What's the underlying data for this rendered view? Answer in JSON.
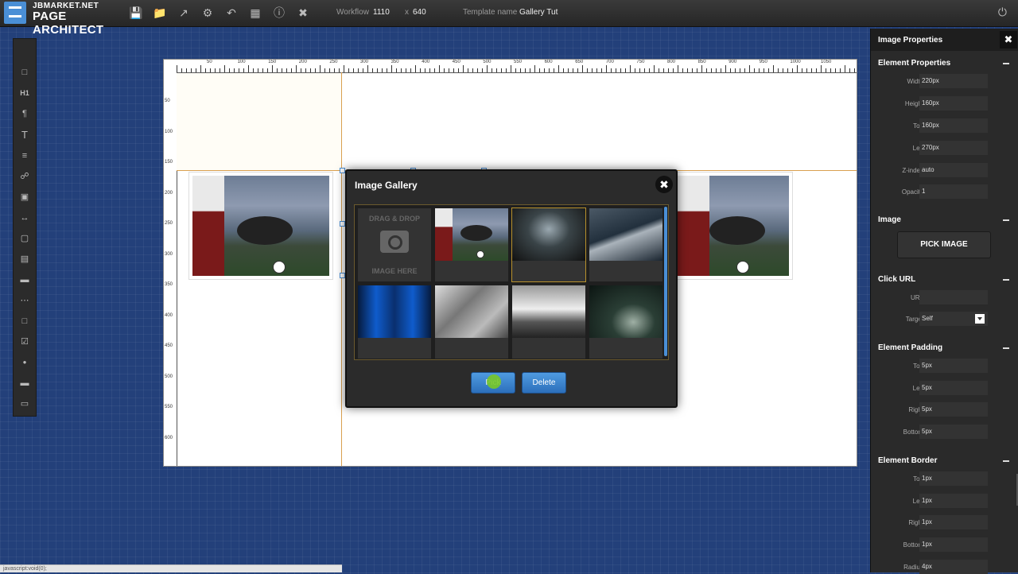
{
  "app": {
    "logo_small": "JBMARKET.NET",
    "logo_big": "PAGE ARCHITECT"
  },
  "toolbar": {
    "workflow_label": "Workflow",
    "workflow_width": "1110",
    "workflow_sep": "x",
    "workflow_height": "640",
    "template_label": "Template name",
    "template_name": "Gallery Tut",
    "icons": [
      "save-icon",
      "folder-icon",
      "export-icon",
      "gear-icon",
      "undo-icon",
      "grid-icon",
      "info-icon",
      "close-icon"
    ]
  },
  "ruler": {
    "top": [
      "50",
      "100",
      "150",
      "200",
      "250",
      "300",
      "350",
      "400",
      "450",
      "500",
      "550",
      "600",
      "650",
      "700",
      "750",
      "800",
      "850",
      "900",
      "950",
      "1000",
      "1050"
    ],
    "left": [
      "50",
      "100",
      "150",
      "200",
      "250",
      "300",
      "350",
      "400",
      "450",
      "500",
      "550",
      "600"
    ]
  },
  "modal": {
    "title": "Image Gallery",
    "dropzone_top": "DRAG & DROP",
    "dropzone_bottom": "IMAGE HERE",
    "pick_label": "Pick",
    "delete_label": "Delete"
  },
  "panel": {
    "title": "Image Properties",
    "element_properties": {
      "title": "Element Properties",
      "rows": [
        {
          "label": "Width",
          "value": "220px"
        },
        {
          "label": "Height",
          "value": "160px"
        },
        {
          "label": "Top",
          "value": "160px"
        },
        {
          "label": "Left",
          "value": "270px"
        },
        {
          "label": "Z-index",
          "value": "auto"
        },
        {
          "label": "Opacity",
          "value": "1"
        }
      ]
    },
    "image": {
      "title": "Image",
      "pick_button": "PICK IMAGE"
    },
    "click_url": {
      "title": "Click URL",
      "url_label": "URL",
      "url_value": "",
      "target_label": "Target",
      "target_value": "Self"
    },
    "padding": {
      "title": "Element Padding",
      "rows": [
        {
          "label": "Top",
          "value": "5px"
        },
        {
          "label": "Left",
          "value": "5px"
        },
        {
          "label": "Right",
          "value": "5px"
        },
        {
          "label": "Bottom",
          "value": "5px"
        }
      ]
    },
    "border": {
      "title": "Element Border",
      "rows": [
        {
          "label": "Top",
          "value": "1px"
        },
        {
          "label": "Left",
          "value": "1px"
        },
        {
          "label": "Right",
          "value": "1px"
        },
        {
          "label": "Bottom",
          "value": "1px"
        },
        {
          "label": "Radius",
          "value": "4px"
        }
      ]
    }
  },
  "status": "javascript:void(0);"
}
